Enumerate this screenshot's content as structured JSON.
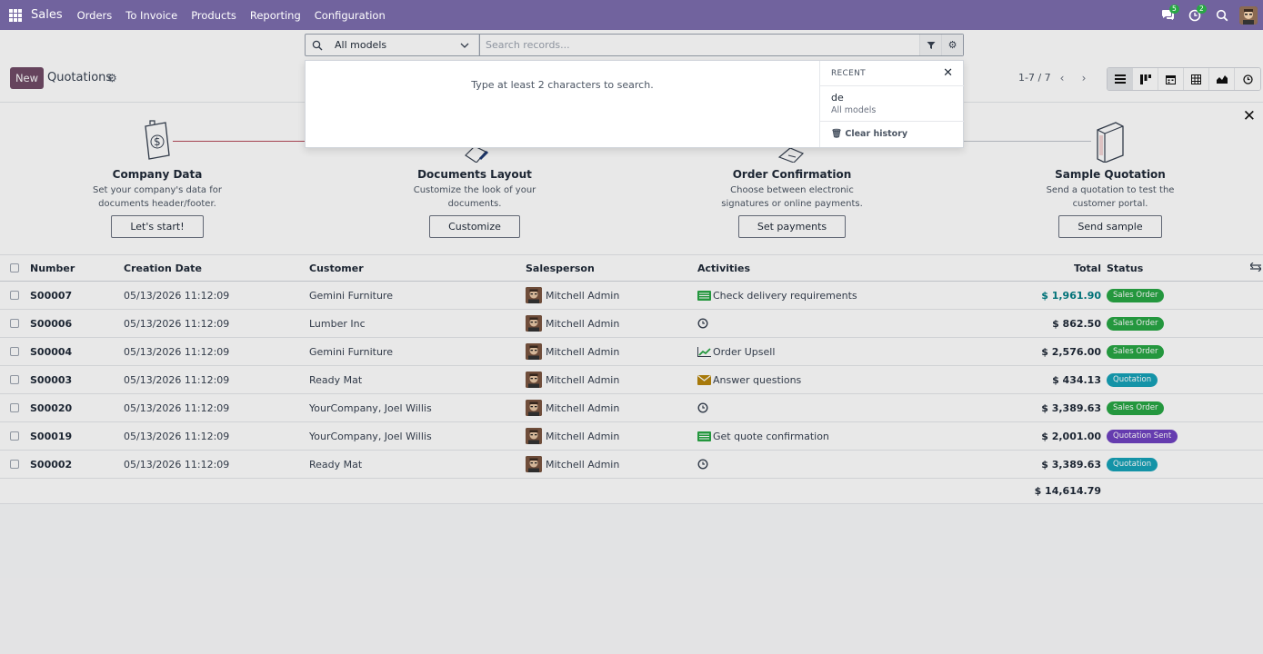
{
  "navbar": {
    "app_name": "Sales",
    "menu": [
      "Orders",
      "To Invoice",
      "Products",
      "Reporting",
      "Configuration"
    ],
    "messages_count": "5",
    "activities_count": "2",
    "brand_color": "#71639e"
  },
  "control": {
    "new_label": "New",
    "title": "Quotations",
    "pager": "1-7 / 7"
  },
  "search": {
    "model": "All models",
    "placeholder": "Search records..."
  },
  "dropdown": {
    "hint": "Type at least 2 characters to search.",
    "recent_label": "RECENT",
    "recent_term": "de",
    "recent_model": "All models",
    "clear_label": "Clear history"
  },
  "onboarding": {
    "steps": [
      {
        "title": "Company Data",
        "desc": "Set your company's data for documents header/footer.",
        "button": "Let's start!"
      },
      {
        "title": "Documents Layout",
        "desc": "Customize the look of your documents.",
        "button": "Customize"
      },
      {
        "title": "Order Confirmation",
        "desc": "Choose between electronic signatures or online payments.",
        "button": "Set payments"
      },
      {
        "title": "Sample Quotation",
        "desc": "Send a quotation to test the customer portal.",
        "button": "Send sample"
      }
    ]
  },
  "table": {
    "headers": {
      "number": "Number",
      "date": "Creation Date",
      "customer": "Customer",
      "salesperson": "Salesperson",
      "activities": "Activities",
      "total": "Total",
      "status": "Status"
    },
    "rows": [
      {
        "number": "S00007",
        "date": "05/13/2026 11:12:09",
        "customer": "Gemini Furniture",
        "salesperson": "Mitchell Admin",
        "activity": "Check delivery requirements",
        "activity_icon": "todo-icon",
        "total": "$ 1,961.90",
        "status": "Sales Order"
      },
      {
        "number": "S00006",
        "date": "05/13/2026 11:12:09",
        "customer": "Lumber Inc",
        "salesperson": "Mitchell Admin",
        "activity": "",
        "activity_icon": "clock-icon",
        "total": "$ 862.50",
        "status": "Sales Order"
      },
      {
        "number": "S00004",
        "date": "05/13/2026 11:12:09",
        "customer": "Gemini Furniture",
        "salesperson": "Mitchell Admin",
        "activity": "Order Upsell",
        "activity_icon": "chart-line-icon",
        "total": "$ 2,576.00",
        "status": "Sales Order"
      },
      {
        "number": "S00003",
        "date": "05/13/2026 11:12:09",
        "customer": "Ready Mat",
        "salesperson": "Mitchell Admin",
        "activity": "Answer questions",
        "activity_icon": "envelope-icon",
        "total": "$ 434.13",
        "status": "Quotation"
      },
      {
        "number": "S00020",
        "date": "05/13/2026 11:12:09",
        "customer": "YourCompany, Joel Willis",
        "salesperson": "Mitchell Admin",
        "activity": "",
        "activity_icon": "clock-icon",
        "total": "$ 3,389.63",
        "status": "Sales Order"
      },
      {
        "number": "S00019",
        "date": "05/13/2026 11:12:09",
        "customer": "YourCompany, Joel Willis",
        "salesperson": "Mitchell Admin",
        "activity": "Get quote confirmation",
        "activity_icon": "todo-icon",
        "total": "$ 2,001.00",
        "status": "Quotation Sent"
      },
      {
        "number": "S00002",
        "date": "05/13/2026 11:12:09",
        "customer": "Ready Mat",
        "salesperson": "Mitchell Admin",
        "activity": "",
        "activity_icon": "clock-icon",
        "total": "$ 3,389.63",
        "status": "Quotation"
      }
    ],
    "sum_total": "$ 14,614.79"
  }
}
